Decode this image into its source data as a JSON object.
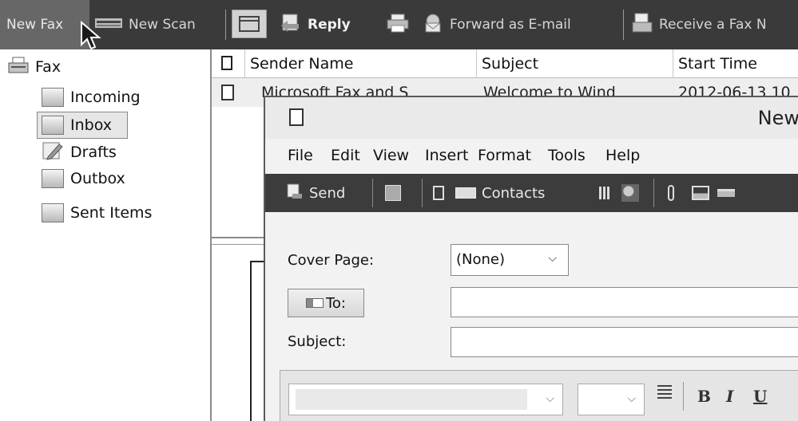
{
  "toolbar": {
    "new_fax": "New Fax",
    "new_scan": "New Scan",
    "reply": "Reply",
    "forward": "Forward as E-mail",
    "receive": "Receive a Fax N"
  },
  "tree": {
    "root": "Fax",
    "items": [
      {
        "label": "Incoming",
        "icon": "incoming-folder-icon"
      },
      {
        "label": "Inbox",
        "icon": "inbox-folder-icon",
        "selected": true
      },
      {
        "label": "Drafts",
        "icon": "drafts-folder-icon"
      },
      {
        "label": "Outbox",
        "icon": "outbox-folder-icon"
      },
      {
        "label": "Sent Items",
        "icon": "sent-items-folder-icon"
      }
    ]
  },
  "list": {
    "columns": [
      "Sender Name",
      "Subject",
      "Start Time"
    ],
    "rows": [
      {
        "sender": "Microsoft Fax and S",
        "subject": "Welcome to Wind",
        "time": "2012-06-13 10"
      }
    ]
  },
  "fax_window": {
    "title": "New",
    "menu": [
      "File",
      "Edit",
      "View",
      "Insert",
      "Format",
      "Tools",
      "Help"
    ],
    "tools": {
      "send": "Send",
      "contacts": "Contacts"
    },
    "cover_page_label": "Cover Page:",
    "cover_page_value": "(None)",
    "to_label": "To:",
    "subject_label": "Subject:",
    "format": {
      "bold": "B",
      "italic": "I",
      "underline": "U"
    }
  },
  "colors": {
    "toolbar_bg": "#3a3a3a",
    "selected_button_bg": "#676767",
    "window_bg": "#f2f2f2"
  }
}
